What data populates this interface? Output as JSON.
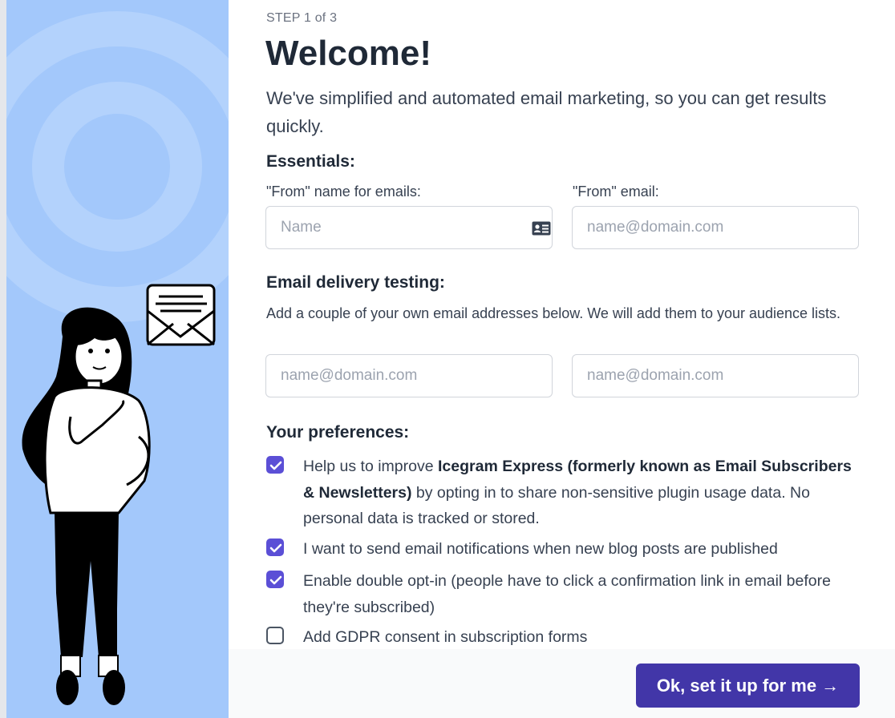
{
  "header": {
    "step": "STEP 1 of 3",
    "title": "Welcome!",
    "intro": "We've simplified and automated email marketing, so you can get results quickly."
  },
  "essentials": {
    "heading": "Essentials:",
    "from_name_label": "\"From\" name for emails:",
    "from_name_placeholder": "Name",
    "from_email_label": "\"From\" email:",
    "from_email_placeholder": "name@domain.com"
  },
  "delivery_testing": {
    "heading": "Email delivery testing:",
    "description": "Add a couple of your own email addresses below. We will add them to your audience lists.",
    "email1_placeholder": "name@domain.com",
    "email2_placeholder": "name@domain.com"
  },
  "preferences": {
    "heading": "Your preferences:",
    "items": [
      {
        "checked": true,
        "text_before": "Help us to improve ",
        "text_bold": "Icegram Express (formerly known as Email Subscribers & Newsletters)",
        "text_after": " by opting in to share non-sensitive plugin usage data. No personal data is tracked or stored."
      },
      {
        "checked": true,
        "text": "I want to send email notifications when new blog posts are published"
      },
      {
        "checked": true,
        "text": "Enable double opt-in (people have to click a confirmation link in email before they're subscribed)"
      },
      {
        "checked": false,
        "text": "Add GDPR consent in subscription forms"
      }
    ]
  },
  "footer": {
    "cta_label": "Ok, set it up for me →"
  },
  "colors": {
    "panel_blue": "#a3c8fb",
    "accent_purple": "#5b4fd6",
    "button_purple": "#4236a8"
  },
  "icons": {
    "name_field": "contact-card-icon",
    "illustration": "envelope-icon"
  }
}
